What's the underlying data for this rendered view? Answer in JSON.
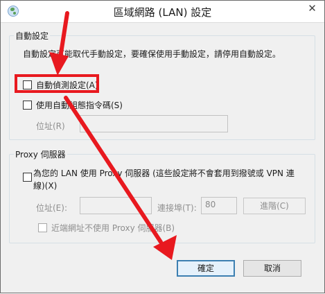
{
  "window": {
    "title": "區域網路 (LAN) 設定",
    "close_label": "✕"
  },
  "auto_config": {
    "group_title": "自動設定",
    "description": "自動設定可能取代手動設定，要確保使用手動設定，請停用自動設定。",
    "auto_detect": {
      "label": "自動偵測設定(A)",
      "checked": false
    },
    "use_script": {
      "label": "使用自動組態指令碼(S)",
      "checked": false
    },
    "address_label": "位址(R)",
    "address_value": ""
  },
  "proxy": {
    "group_title": "Proxy 伺服器",
    "use_proxy": {
      "label": "為您的 LAN 使用 Proxy 伺服器 (這些設定將不會套用到撥號或 VPN 連線)(X)",
      "checked": false
    },
    "address_label": "位址(E):",
    "address_value": "",
    "port_label": "連接埠(T):",
    "port_value": "80",
    "advanced_label": "進階(C)",
    "bypass_local": {
      "label": "近端網址不使用 Proxy 伺服器(B)",
      "checked": false
    }
  },
  "footer": {
    "ok_label": "確定",
    "cancel_label": "取消"
  },
  "colors": {
    "annotation": "#e8191f",
    "default_button_border": "#3c7fb1"
  }
}
